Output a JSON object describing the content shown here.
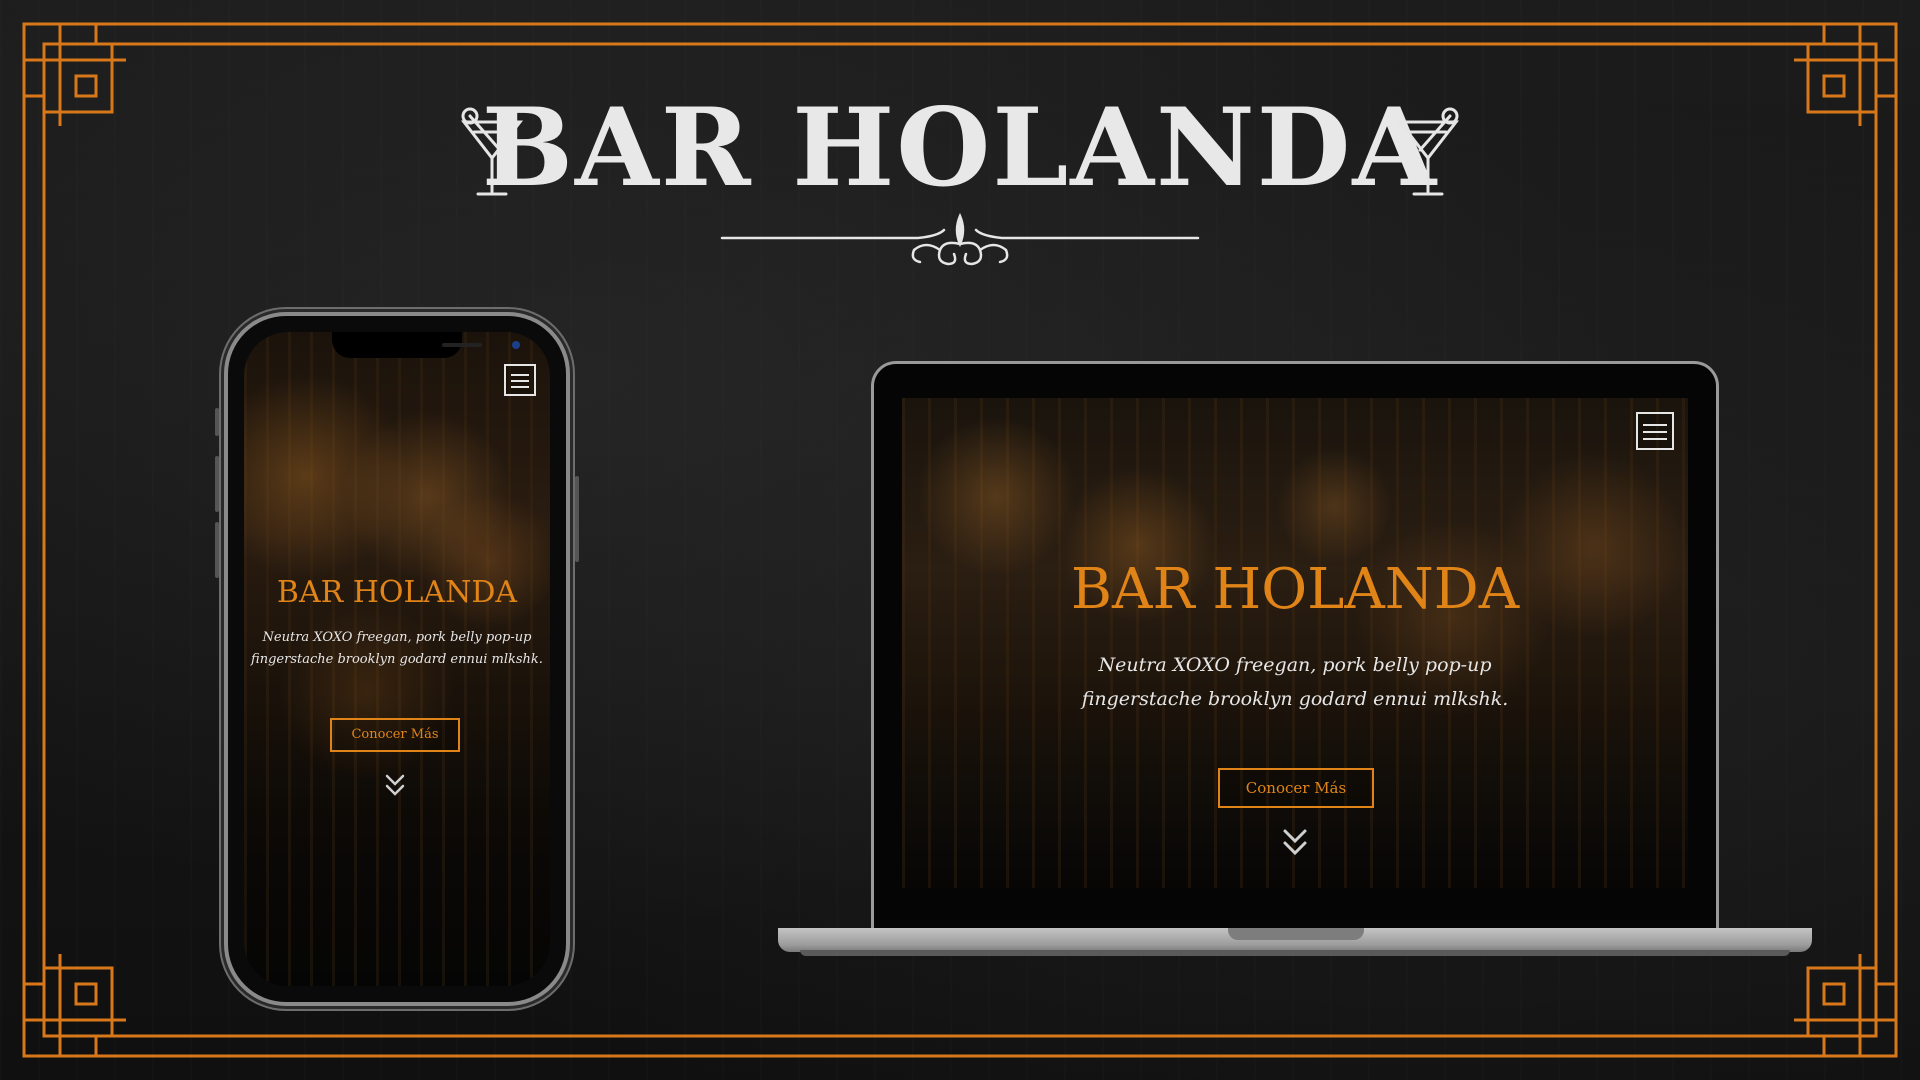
{
  "page": {
    "title": "BAR HOLANDA",
    "accent_color": "#e08418",
    "frame_color": "#d9781a"
  },
  "icons": {
    "left_decoration": "martini-glass-icon",
    "right_decoration": "martini-glass-icon",
    "divider": "flourish-ornament-icon",
    "menu": "hamburger-menu-icon",
    "scroll": "double-chevron-down-icon"
  },
  "mobile_site": {
    "title": "BAR HOLANDA",
    "tagline_line1": "Neutra XOXO freegan, pork belly pop-up",
    "tagline_line2": "fingerstache brooklyn godard ennui mlkshk.",
    "button_label": "Conocer Más"
  },
  "desktop_site": {
    "title": "BAR HOLANDA",
    "tagline_line1": "Neutra XOXO freegan, pork belly pop-up",
    "tagline_line2": "fingerstache brooklyn godard ennui mlkshk.",
    "button_label": "Conocer Más"
  }
}
